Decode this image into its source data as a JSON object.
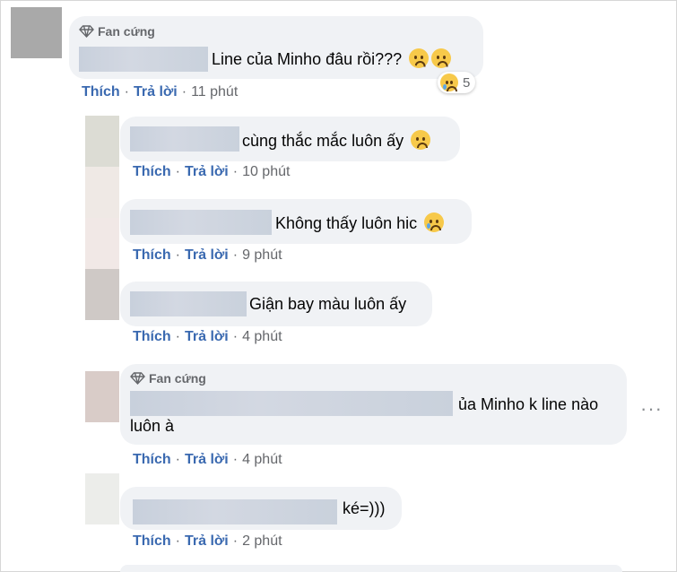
{
  "comments": [
    {
      "badge": "Fan cứng",
      "text": "Line của Minho đâu rồi???",
      "like": "Thích",
      "reply": "Trả lời",
      "time": "11 phút",
      "reaction_count": "5"
    },
    {
      "text": "cùng thắc mắc luôn ấy",
      "like": "Thích",
      "reply": "Trả lời",
      "time": "10 phút"
    },
    {
      "text": "Không thấy luôn hic",
      "like": "Thích",
      "reply": "Trả lời",
      "time": "9 phút"
    },
    {
      "text": "Giận bay màu luôn ấy",
      "like": "Thích",
      "reply": "Trả lời",
      "time": "4 phút"
    },
    {
      "badge": "Fan cứng",
      "text_line1": "ủa Minho k line nào",
      "text_line2": "luôn à",
      "like": "Thích",
      "reply": "Trả lời",
      "time": "4 phút",
      "more": "···"
    },
    {
      "text": "ké=)))",
      "like": "Thích",
      "reply": "Trả lời",
      "time": "2 phút"
    }
  ],
  "icons": [
    "diamond-icon",
    "confused-emoji-icon",
    "sad-emoji-icon",
    "crying-emoji-icon",
    "more-options-icon"
  ],
  "colors": {
    "bubble": "#f0f2f5",
    "link": "#3a69b0",
    "muted": "#65676b"
  }
}
